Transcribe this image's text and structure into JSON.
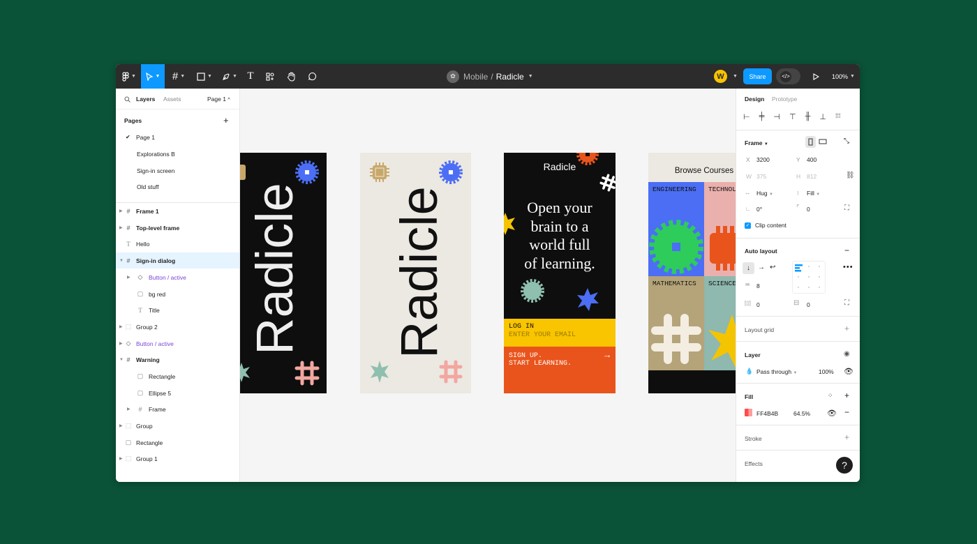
{
  "toolbar": {
    "project": "Mobile",
    "separator": "/",
    "file": "Radicle",
    "avatar_initial": "W",
    "share_label": "Share",
    "zoom": "100%",
    "accent": "#0d99ff"
  },
  "left": {
    "tab_layers": "Layers",
    "tab_assets": "Assets",
    "page_selector": "Page 1",
    "pages_title": "Pages",
    "pages": [
      "Page 1",
      "Explorations B",
      "Sign-in screen",
      "Old stuff"
    ],
    "layers": [
      {
        "label": "Frame 1",
        "icon": "frame-icon"
      },
      {
        "label": "Top-level frame",
        "icon": "frame-icon"
      },
      {
        "label": "Hello",
        "icon": "text-icon"
      },
      {
        "label": "Sign-in dialog",
        "icon": "frame-icon"
      },
      {
        "label": "Button / active",
        "icon": "component-icon"
      },
      {
        "label": "bg red",
        "icon": "rectangle-icon"
      },
      {
        "label": "Title",
        "icon": "text-icon"
      },
      {
        "label": "Group 2",
        "icon": "group-icon"
      },
      {
        "label": "Button / active",
        "icon": "component-icon"
      },
      {
        "label": "Warning",
        "icon": "frame-icon"
      },
      {
        "label": "Rectangle",
        "icon": "rectangle-icon"
      },
      {
        "label": "Ellipse 5",
        "icon": "rectangle-icon"
      },
      {
        "label": "Frame",
        "icon": "frame-icon"
      },
      {
        "label": "Group",
        "icon": "group-icon"
      },
      {
        "label": "Rectangle",
        "icon": "rectangle-icon"
      },
      {
        "label": "Group 1",
        "icon": "group-icon"
      }
    ]
  },
  "canvas": {
    "brand": "Radicle",
    "screen3": {
      "logo": "Radicle",
      "headline_1": "Open your",
      "headline_2": "brain to a",
      "headline_3": "world full",
      "headline_4": "of learning.",
      "login": "LOG IN",
      "email_placeholder": "ENTER YOUR EMAIL",
      "signup_1": "SIGN UP.",
      "signup_2": "START LEARNING."
    },
    "screen4": {
      "title": "Browse Courses",
      "courses": [
        "ENGINEERING",
        "TECHNOL",
        "MATHEMATICS",
        "SCIENCE"
      ]
    }
  },
  "right": {
    "tab_design": "Design",
    "tab_prototype": "Prototype",
    "frame_label": "Frame",
    "x_label": "X",
    "x_value": "3200",
    "y_label": "Y",
    "y_value": "400",
    "w_label": "W",
    "w_value": "375",
    "h_label": "H",
    "h_value": "812",
    "hug_label": "Hug",
    "fill_size_label": "Fill",
    "rotation": "0°",
    "radius": "0",
    "clip_label": "Clip content",
    "autolayout_title": "Auto layout",
    "gap": "8",
    "pad_h": "0",
    "pad_v": "0",
    "layout_grid": "Layout grid",
    "layer_title": "Layer",
    "blend": "Pass through",
    "opacity": "100%",
    "fill_title": "Fill",
    "fill_hex": "FF4B4B",
    "fill_opacity": "64.5%",
    "fill_color": "#ff4b4b",
    "stroke_title": "Stroke",
    "effects_title": "Effects",
    "help": "?"
  }
}
